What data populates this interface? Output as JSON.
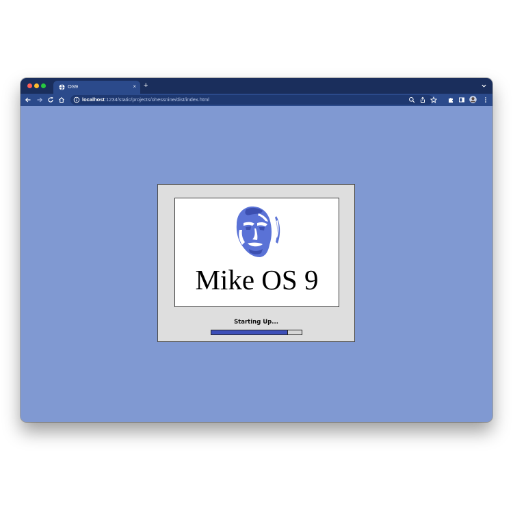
{
  "browser": {
    "tab_title": "OS9",
    "tab_close": "×",
    "new_tab": "+",
    "url_host": "localhost",
    "url_path": ":1234/static/projects/ohessnine/dist/index.html",
    "icons": {
      "favicon": "globe-icon",
      "back": "arrow-left-icon",
      "forward": "arrow-right-icon",
      "reload": "reload-icon",
      "home": "home-icon",
      "site_info": "info-icon",
      "zoom": "zoom-icon",
      "share": "share-icon",
      "bookmark": "star-icon",
      "extensions": "puzzle-icon",
      "side_panel": "side-panel-icon",
      "profile": "avatar",
      "menu": "kebab-menu-icon",
      "tab_search": "chevron-down-icon"
    }
  },
  "page": {
    "background_color": "#8099d2",
    "title": "Mike OS 9",
    "status": "Starting Up...",
    "progress": 0.85,
    "progress_color": "#3d4fb8",
    "logo_color": "#5a72d6"
  }
}
